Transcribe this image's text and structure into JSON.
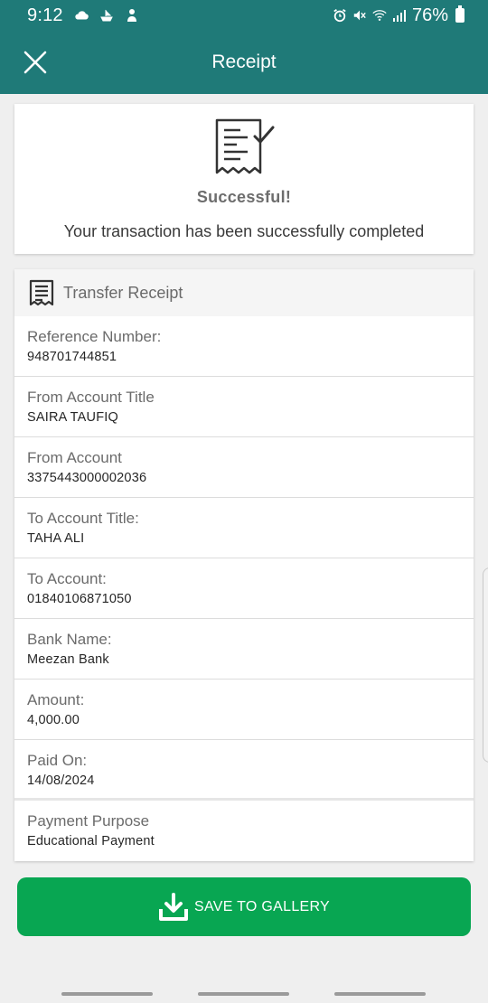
{
  "status_bar": {
    "time": "9:12",
    "battery": "76%"
  },
  "app_bar": {
    "title": "Receipt",
    "close_icon": "close-icon"
  },
  "success": {
    "icon": "receipt-check-icon",
    "title": "Successful!",
    "message": "Your transaction has been successfully completed"
  },
  "receipt": {
    "header_icon": "receipt-icon",
    "header_label": "Transfer Receipt",
    "rows": [
      {
        "label": "Reference Number:",
        "value": "948701744851"
      },
      {
        "label": "From Account Title",
        "value": "SAIRA TAUFIQ"
      },
      {
        "label": "From Account",
        "value": "3375443000002036"
      },
      {
        "label": "To Account Title:",
        "value": "TAHA ALI"
      },
      {
        "label": "To Account:",
        "value": "01840106871050"
      },
      {
        "label": "Bank Name:",
        "value": "Meezan Bank"
      },
      {
        "label": "Amount:",
        "value": "4,000.00"
      },
      {
        "label": "Paid On:",
        "value": "14/08/2024"
      },
      {
        "label": "Payment Purpose",
        "value": "Educational Payment"
      }
    ]
  },
  "actions": {
    "save_label": "SAVE TO GALLERY",
    "save_icon": "download-icon"
  },
  "colors": {
    "header": "#1f7a78",
    "button": "#08a652",
    "background": "#efefef"
  }
}
